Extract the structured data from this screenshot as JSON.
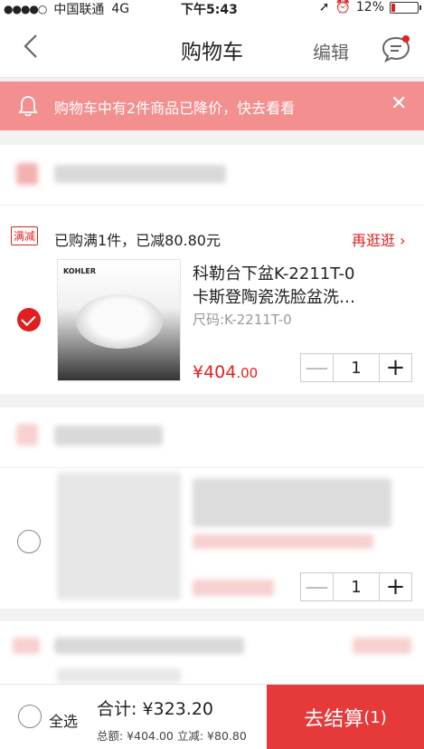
{
  "status": {
    "carrier": "中国联通",
    "network": "4G",
    "time": "下午5:43",
    "battery": "12%"
  },
  "nav": {
    "title": "购物车",
    "edit": "编辑"
  },
  "notice": {
    "text": "购物车中有2件商品已降价，快去看看",
    "close": "✕"
  },
  "promo": {
    "tag": "满减",
    "desc": "已购满1件，已减80.80元",
    "more": "再逛逛"
  },
  "item1": {
    "brand": "KOHLER",
    "name_line1": "科勒台下盆K-2211T-0",
    "name_line2": "卡斯登陶瓷洗脸盆洗…",
    "spec": "尺码:K-2211T-0",
    "price_main": "¥404",
    "price_cents": ".00",
    "qty": "1",
    "checked": true
  },
  "item2": {
    "qty": "1",
    "checked": false
  },
  "stepper": {
    "minus": "—",
    "plus": "+"
  },
  "footer": {
    "select_all": "全选",
    "total": "合计: ¥323.20",
    "breakdown": "总额: ¥404.00 立减: ¥80.80",
    "checkout": "去结算",
    "checkout_count": "(1)"
  },
  "colors": {
    "accent": "#e02020",
    "notice_bg": "#f38f8f",
    "checkout_bg": "#e63a3a"
  }
}
